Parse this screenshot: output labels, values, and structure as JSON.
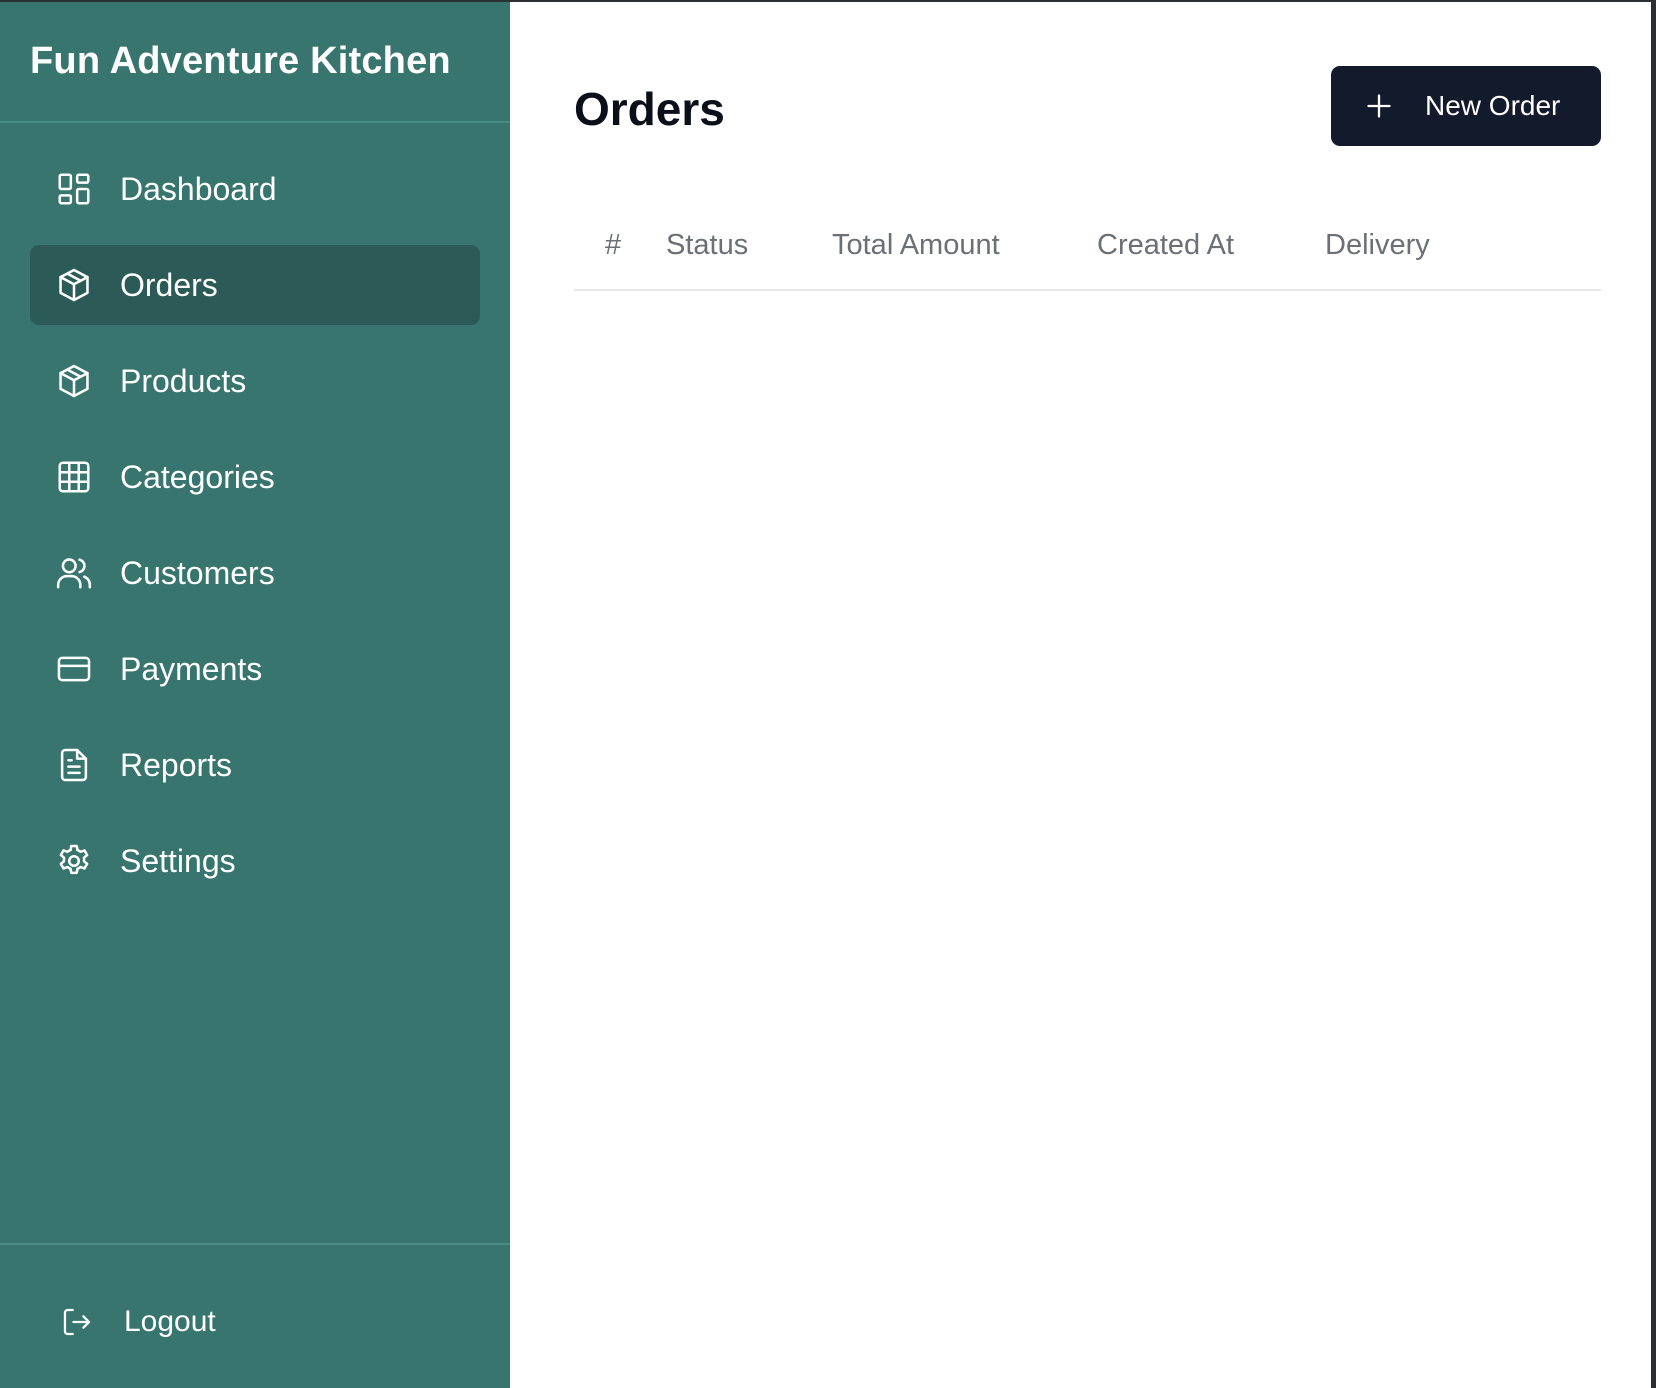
{
  "app": {
    "brand": "Fun Adventure Kitchen"
  },
  "sidebar": {
    "items": [
      {
        "label": "Dashboard",
        "icon": "dashboard-icon",
        "active": false
      },
      {
        "label": "Orders",
        "icon": "box-icon",
        "active": true
      },
      {
        "label": "Products",
        "icon": "box-icon",
        "active": false
      },
      {
        "label": "Categories",
        "icon": "grid-icon",
        "active": false
      },
      {
        "label": "Customers",
        "icon": "users-icon",
        "active": false
      },
      {
        "label": "Payments",
        "icon": "credit-card-icon",
        "active": false
      },
      {
        "label": "Reports",
        "icon": "document-icon",
        "active": false
      },
      {
        "label": "Settings",
        "icon": "gear-icon",
        "active": false
      }
    ],
    "logout": {
      "label": "Logout",
      "icon": "logout-icon"
    }
  },
  "main": {
    "title": "Orders",
    "new_order_label": "New Order",
    "table": {
      "columns": [
        "#",
        "Status",
        "Total Amount",
        "Created At",
        "Delivery"
      ],
      "rows": []
    }
  },
  "colors": {
    "sidebar_bg": "#38756e",
    "sidebar_active_bg": "#2c5b57",
    "primary_button_bg": "#121a2c"
  }
}
